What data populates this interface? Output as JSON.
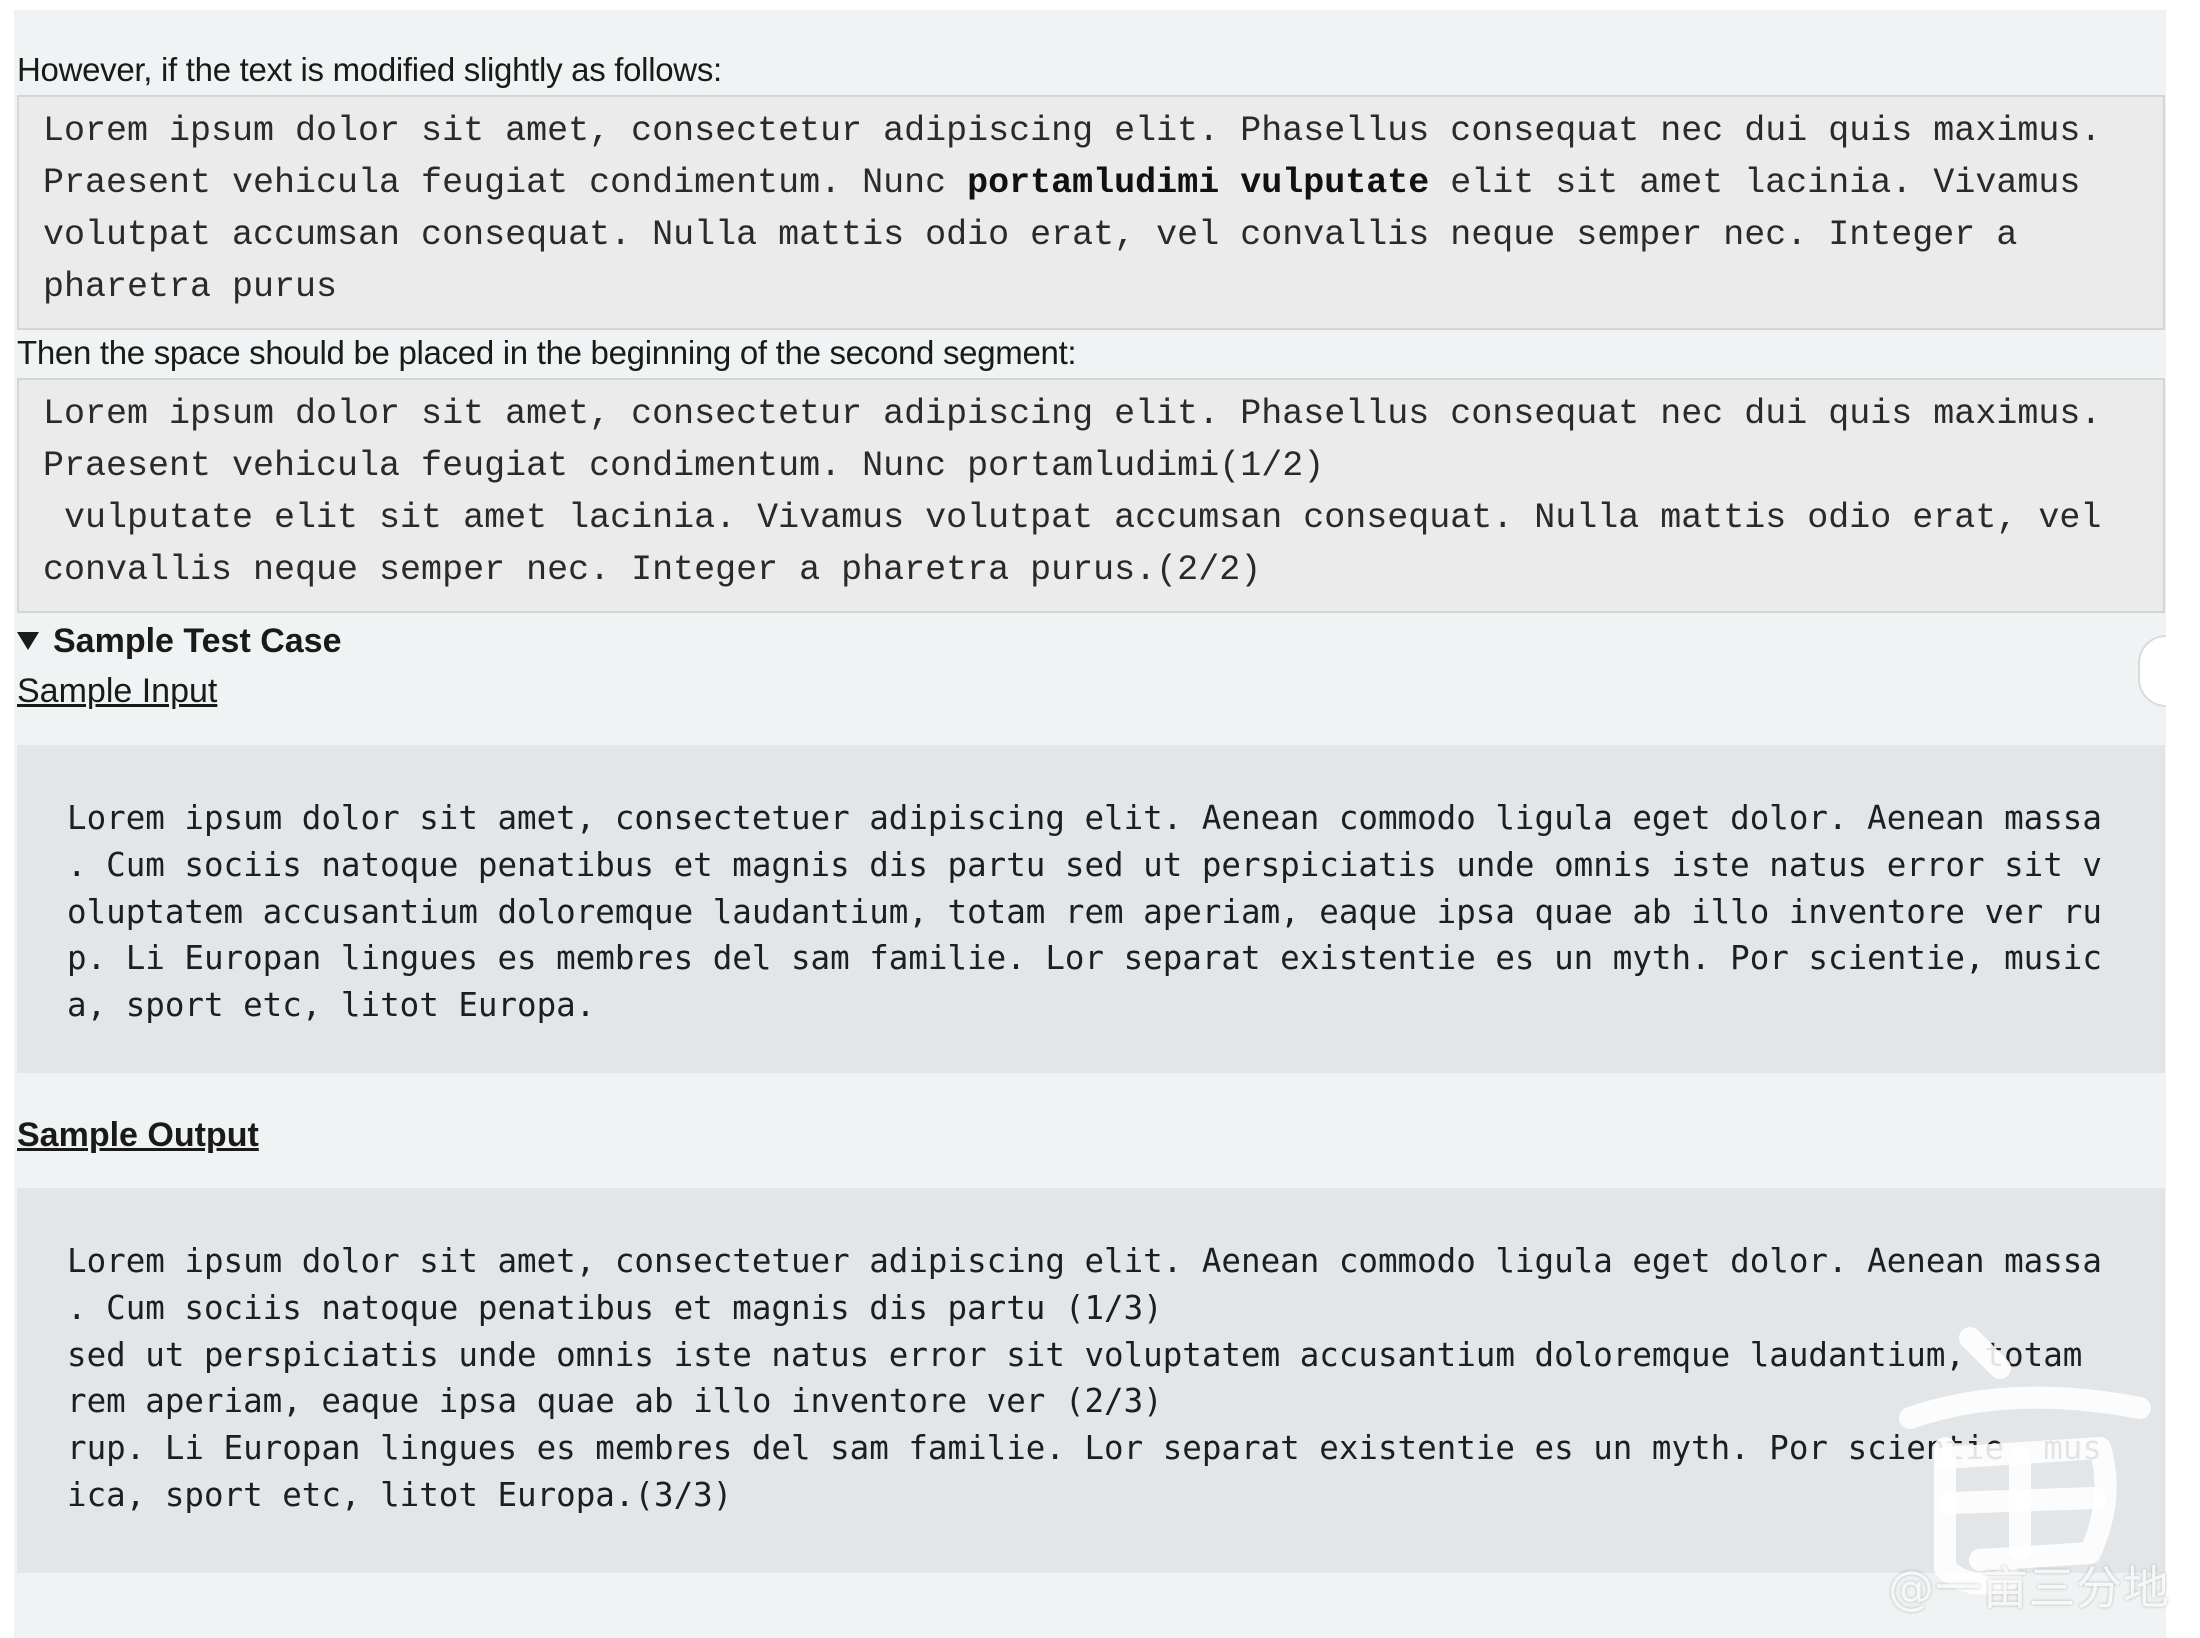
{
  "intro_paragraph": "However, if the text is modified slightly as follows:",
  "example1": {
    "lines": [
      [
        {
          "t": "Lorem ipsum dolor sit amet, consectetur adipiscing elit. Phasellus consequat nec dui quis maximus."
        }
      ],
      [
        {
          "t": "Praesent vehicula feugiat condimentum. Nunc "
        },
        {
          "t": "portamludimi vulputate",
          "b": true
        },
        {
          "t": " elit sit amet lacinia. Vivamus"
        }
      ],
      [
        {
          "t": "volutpat accumsan consequat. Nulla mattis odio erat, vel convallis neque semper nec. Integer a"
        }
      ],
      [
        {
          "t": "pharetra purus"
        }
      ]
    ]
  },
  "then_paragraph": "Then the space should be placed in the beginning of the second segment:",
  "example2": {
    "lines": [
      "Lorem ipsum dolor sit amet, consectetur adipiscing elit. Phasellus consequat nec dui quis maximus.",
      "Praesent vehicula feugiat condimentum. Nunc portamludimi(1/2)",
      " vulputate elit sit amet lacinia. Vivamus volutpat accumsan consequat. Nulla mattis odio erat, vel",
      "convallis neque semper nec. Integer a pharetra purus.(2/2)"
    ]
  },
  "sample_test_case_label": "Sample Test Case",
  "sample_input_label": "Sample Input",
  "sample_input_lines": [
    "Lorem ipsum dolor sit amet, consectetuer adipiscing elit. Aenean commodo ligula eget dolor. Aenean massa",
    ". Cum sociis natoque penatibus et magnis dis partu sed ut perspiciatis unde omnis iste natus error sit v",
    "oluptatem accusantium doloremque laudantium, totam rem aperiam, eaque ipsa quae ab illo inventore ver ru",
    "p. Li Europan lingues es membres del sam familie. Lor separat existentie es un myth. Por scientie, music",
    "a, sport etc, litot Europa."
  ],
  "sample_output_label": "Sample Output",
  "sample_output_lines": [
    "Lorem ipsum dolor sit amet, consectetuer adipiscing elit. Aenean commodo ligula eget dolor. Aenean massa",
    ". Cum sociis natoque penatibus et magnis dis partu (1/3)",
    "sed ut perspiciatis unde omnis iste natus error sit voluptatem accusantium doloremque laudantium, totam",
    "rem aperiam, eaque ipsa quae ab illo inventore ver (2/3)",
    "rup. Li Europan lingues es membres del sam familie. Lor separat existentie es un myth. Por scientie, mus",
    "ica, sport etc, litot Europa.(3/3)"
  ],
  "watermark": "@一亩三分地",
  "watermark_glyph": "亩",
  "icons": {
    "disclosure": "triangle-down-icon",
    "scroll": "scroll-handle"
  }
}
